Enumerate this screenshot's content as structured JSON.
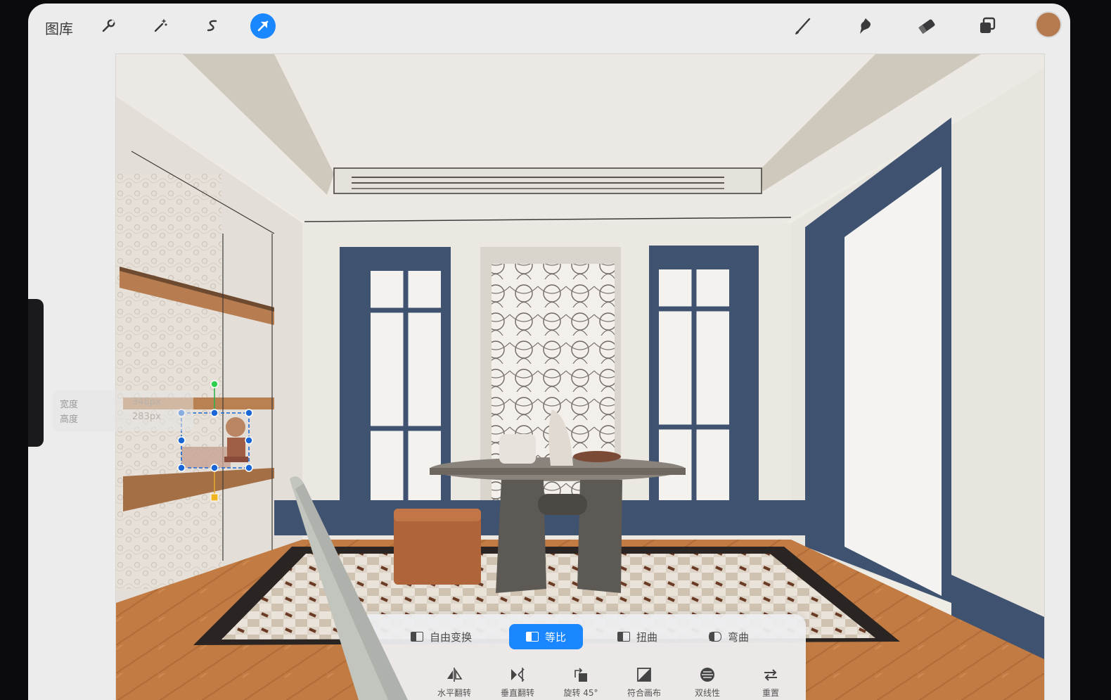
{
  "toolbar": {
    "gallery_label": "图库",
    "left_tools": [
      "wrench-icon",
      "magic-wand-icon",
      "selection-icon",
      "transform-arrow-icon"
    ],
    "active_tool": "transform-arrow-icon",
    "right_tools": [
      "brush-icon",
      "smudge-icon",
      "eraser-icon",
      "layers-icon"
    ],
    "current_color": "#b67a4f"
  },
  "dimensions": {
    "width_label": "宽度",
    "width_value": "348px",
    "height_label": "高度",
    "height_value": "283px"
  },
  "transform_panel": {
    "modes": [
      {
        "label": "自由变换",
        "active": false
      },
      {
        "label": "等比",
        "active": true
      },
      {
        "label": "扭曲",
        "active": false
      },
      {
        "label": "弯曲",
        "active": false
      }
    ],
    "actions": [
      "水平翻转",
      "垂直翻转",
      "旋转 45°",
      "符合画布",
      "双线性",
      "重置"
    ]
  },
  "colors": {
    "accent": "#1a86ff",
    "trim_navy": "#3f5370",
    "floor_wood": "#c17a42"
  }
}
